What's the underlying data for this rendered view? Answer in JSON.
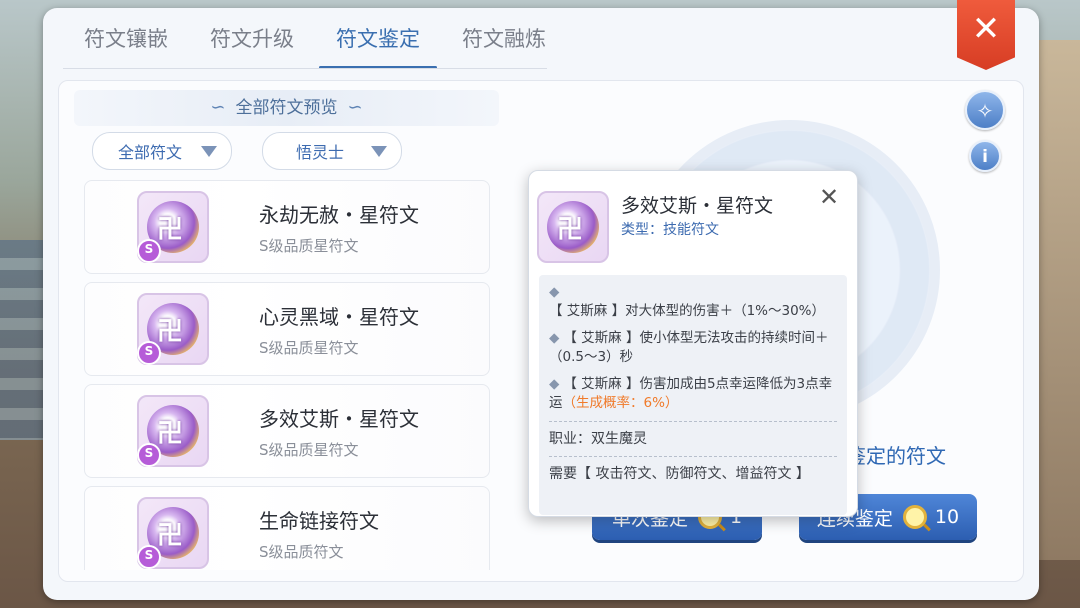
{
  "tabs": [
    "符文镶嵌",
    "符文升级",
    "符文鉴定",
    "符文融炼"
  ],
  "active_tab_index": 2,
  "close_label": "✕",
  "list": {
    "header": "全部符文预览",
    "filter_type": "全部符文",
    "filter_class": "悟灵士",
    "items": [
      {
        "name": "永劫无赦・星符文",
        "quality": "S级品质星符文",
        "badge": "S"
      },
      {
        "name": "心灵黑域・星符文",
        "quality": "S级品质星符文",
        "badge": "S"
      },
      {
        "name": "多效艾斯・星符文",
        "quality": "S级品质星符文",
        "badge": "S"
      },
      {
        "name": "生命链接符文",
        "quality": "S级品质符文",
        "badge": "S"
      }
    ]
  },
  "identify_area": {
    "hint_partial": "鉴定的符文",
    "single_button": {
      "label": "单次鉴定",
      "count": "1"
    },
    "multi_button": {
      "label": "连续鉴定",
      "count": "10"
    }
  },
  "tooltip": {
    "title": "多效艾斯・星符文",
    "type": "类型：技能符文",
    "effects": [
      {
        "text": "【 艾斯麻 】对大体型的伤害＋（1%～30%）",
        "highlight": ""
      },
      {
        "text": "【 艾斯麻 】使小体型无法攻击的持续时间＋（0.5～3）秒",
        "highlight": ""
      },
      {
        "text": "【 艾斯麻 】伤害加成由5点幸运降低为3点幸运",
        "highlight": "（生成概率：6%）"
      }
    ],
    "job": "职业：双生魔灵",
    "requirement": "需要【 攻击符文、防御符文、增益符文 】",
    "close_label": "✕"
  },
  "icons": {
    "close": "close-icon",
    "dropdown": "triangle-down-icon",
    "magic_wand": "magic-wand-icon",
    "info": "info-icon",
    "magnifier": "magnifier-icon"
  },
  "colors": {
    "accent": "#3a6fb0",
    "close_red": "#e04a2c",
    "highlight_orange": "#f07a2a"
  }
}
